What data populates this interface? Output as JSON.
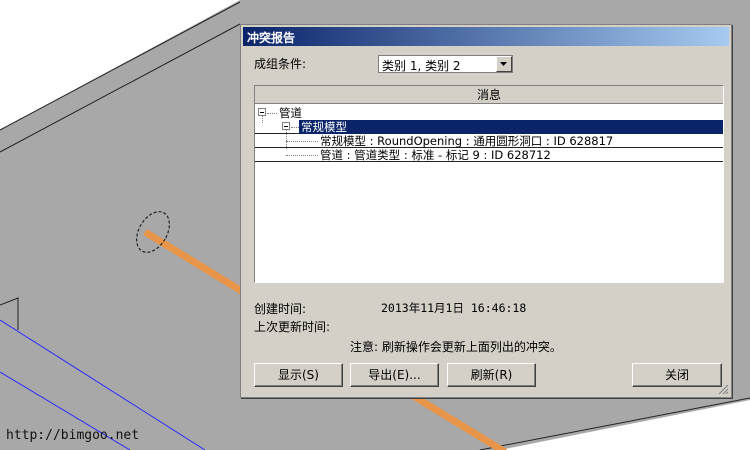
{
  "watermark": "http://bimgoo.net",
  "dialog": {
    "title": "冲突报告",
    "group_by_label": "成组条件:",
    "group_by_value": "类别 1, 类别 2",
    "column_header": "消息",
    "tree": [
      {
        "text": "管道",
        "level": 0,
        "expanded": true,
        "selected": false
      },
      {
        "text": "常规模型",
        "level": 1,
        "expanded": true,
        "selected": true
      },
      {
        "text": "常规模型 : RoundOpening : 通用圆形洞口 : ID 628817",
        "level": 2,
        "selected": false
      },
      {
        "text": "管道 : 管道类型 : 标准 - 标记 9 : ID 628712",
        "level": 2,
        "selected": false
      }
    ],
    "created_label": "创建时间:",
    "created_value": "2013年11月1日  16:46:18",
    "updated_label": "上次更新时间:",
    "note": "注意: 刷新操作会更新上面列出的冲突。",
    "buttons": {
      "show": "显示(S)",
      "export": "导出(E)...",
      "refresh": "刷新(R)",
      "close": "关闭"
    }
  },
  "colors": {
    "dialog_bg": "#d4d0c8",
    "selection": "#0a246a",
    "pipe": "#e8954a",
    "model_fill": "#a8a8a8"
  }
}
